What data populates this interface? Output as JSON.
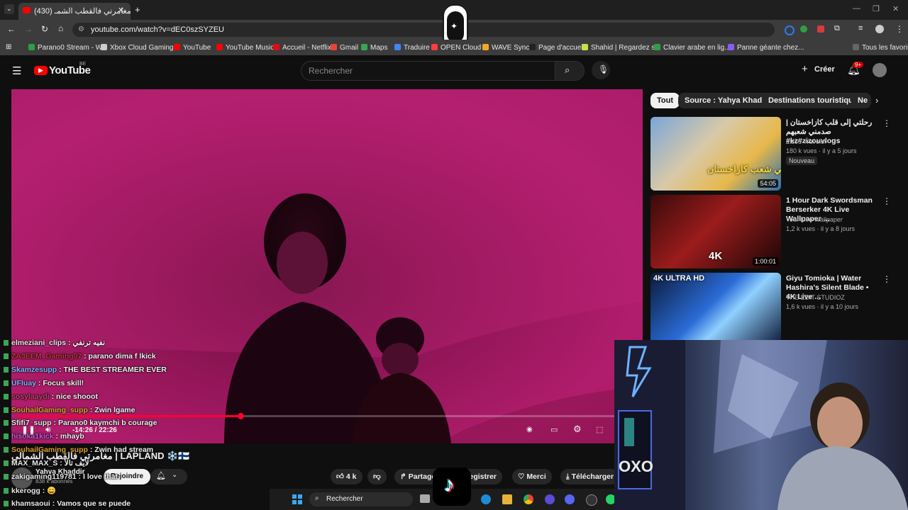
{
  "browser": {
    "tab_title": "مغامرتي فالقطب الشمـ (430)",
    "new_tab_icon": "plus-icon",
    "url": "youtube.com/watch?v=dEC0szSYZEU",
    "bookmarks": [
      {
        "label": "Parano0 Stream - W...",
        "color": "#2ea043"
      },
      {
        "label": "Xbox Cloud Gaming...",
        "color": "#cccccc"
      },
      {
        "label": "YouTube",
        "color": "#ff0000"
      },
      {
        "label": "YouTube Music",
        "color": "#ff0000"
      },
      {
        "label": "Accueil - Netflix",
        "color": "#e50914"
      },
      {
        "label": "Gmail",
        "color": "#ea4335"
      },
      {
        "label": "Maps",
        "color": "#34a853"
      },
      {
        "label": "Traduire",
        "color": "#4285f4"
      },
      {
        "label": "OPEN Cloud",
        "color": "#ff3b3b"
      },
      {
        "label": "WAVE Sync",
        "color": "#f5a623"
      },
      {
        "label": "Page d'accueil",
        "color": "#222222"
      },
      {
        "label": "Shahid | Regardez s...",
        "color": "#c4e34a"
      },
      {
        "label": "Clavier arabe en lig...",
        "color": "#2ea043"
      },
      {
        "label": "Panne géante chez...",
        "color": "#8a5cf6"
      }
    ],
    "all_favorites": "Tous les favoris"
  },
  "youtube": {
    "logo": "YouTube",
    "region": "BE",
    "search_placeholder": "Rechercher",
    "create_label": "Créer",
    "notif_count": "9+",
    "chips": [
      "Tout",
      "Source : Yahya Khaddir",
      "Destinations touristiques",
      "Ne"
    ],
    "recommendations": [
      {
        "title": "رحلتي إلى قلب كازاخستان | صدمني شعبهم #kz#zizouvlogs",
        "channel": "Zizou Traveler",
        "meta": "180 k vues · il y a 5 jours",
        "badge": "Nouveau",
        "duration": "54:05",
        "thumb_text": "صدمني شعب كازاخستان!"
      },
      {
        "title": "1 Hour Dark Swordsman Berserker 4K Live Wallpaper ...",
        "channel": "Your Live Wallpaper",
        "meta": "1,2 k vues · il y a 8 jours",
        "badge": "",
        "duration": "1:00:01",
        "thumb_text": "4K"
      },
      {
        "title": "Giyu Tomioka | Water Hashira's Silent Blade • 4K Live ...",
        "channel": "THE EDIT STUDIOZ",
        "meta": "1,6 k vues · il y a 10 jours",
        "badge": "",
        "duration": "",
        "thumb_text": "4K ULTRA HD"
      }
    ],
    "player": {
      "time": "-14:26 / 22:26",
      "progress": 0.36
    },
    "video_title": "مغامرتي فالقطب الشمالي | LAPLAND ❄️🇫🇮",
    "channel_name": "Yahya Khaddir",
    "subscribers": "838 k abonnés",
    "join_label": "Rejoindre",
    "likes": "4 k",
    "share_label": "Partager",
    "save_label": "Enregistrer",
    "thanks_label": "Merci",
    "download_label": "Télécharger"
  },
  "chat": [
    {
      "user": "elmeziani_clips",
      "msg": "نفيه ترنفي",
      "color": "#e8e8e8"
    },
    {
      "user": "ZA3EEM_Gaming07",
      "msg": "parano dima f lkick",
      "color": "#b83a3a"
    },
    {
      "user": "Skamzesupp",
      "msg": "THE BEST STREAMER EVER",
      "color": "#7fb5ff"
    },
    {
      "user": "UFluay",
      "msg": "Focus skill!",
      "color": "#7fb5ff"
    },
    {
      "user": "sosylaaydi",
      "msg": "nice shooot",
      "color": "#b8486a"
    },
    {
      "user": "SouhailGaming_supp",
      "msg": "Zwin lgame",
      "color": "#e0a030"
    },
    {
      "user": "Sfifi7_supp",
      "msg": "Parano0 kaymchi b courage",
      "color": "#e8e8e8"
    },
    {
      "user": "hisoka1kick",
      "msg": "mhayb",
      "color": "#c060d8"
    },
    {
      "user": "SouhailGaming_supp",
      "msg": "Zwin had stream",
      "color": "#e0a030"
    },
    {
      "user": "MAX_MAX_S",
      "msg": "لايف تالأ",
      "color": "#e8e8e8"
    },
    {
      "user": "zakigaming119781",
      "msg": "I love that",
      "color": "#e8e8e8"
    },
    {
      "user": "kkerogg",
      "msg": "😄",
      "color": "#e8e8e8"
    },
    {
      "user": "khamsaoui",
      "msg": "Vamos que se puede",
      "color": "#e8e8e8"
    }
  ],
  "taskbar": {
    "search_placeholder": "Rechercher"
  },
  "colors": {
    "youtube_red": "#ff0000",
    "progress_red": "#ff0033",
    "video_magenta": "#b01d6c"
  }
}
